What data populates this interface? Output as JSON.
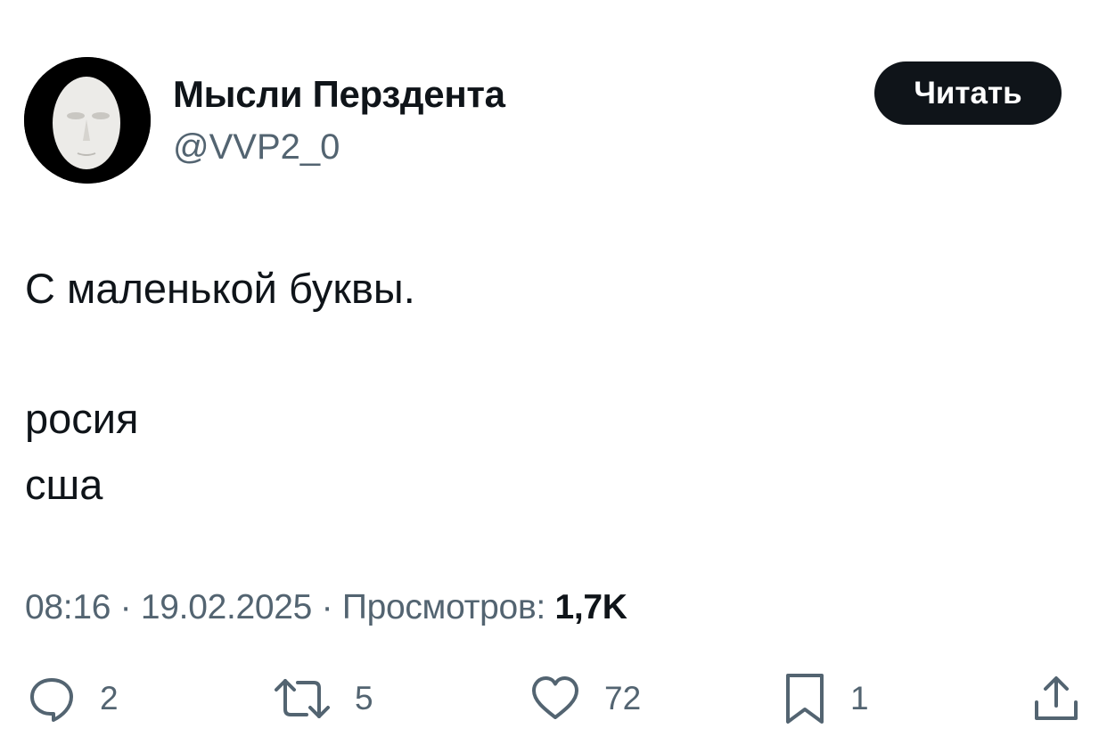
{
  "author": {
    "name": "Мысли Перздента",
    "handle": "@VVP2_0"
  },
  "follow_button": {
    "label": "Читать"
  },
  "tweet": {
    "lines": [
      "С маленькой буквы.",
      "росия",
      "сша"
    ]
  },
  "meta": {
    "time": "08:16",
    "separator": " · ",
    "date": "19.02.2025",
    "views_label": "Просмотров:",
    "views_count": "1,7K"
  },
  "actions": {
    "replies": "2",
    "reposts": "5",
    "likes": "72",
    "bookmarks": "1"
  },
  "icons": {
    "reply": "speech-bubble-icon",
    "repost": "repost-arrows-icon",
    "like": "heart-icon",
    "bookmark": "bookmark-icon",
    "share": "share-upload-icon"
  },
  "colors": {
    "text": "#0f1419",
    "secondary": "#536471",
    "button_bg": "#0f1419",
    "button_text": "#ffffff"
  }
}
